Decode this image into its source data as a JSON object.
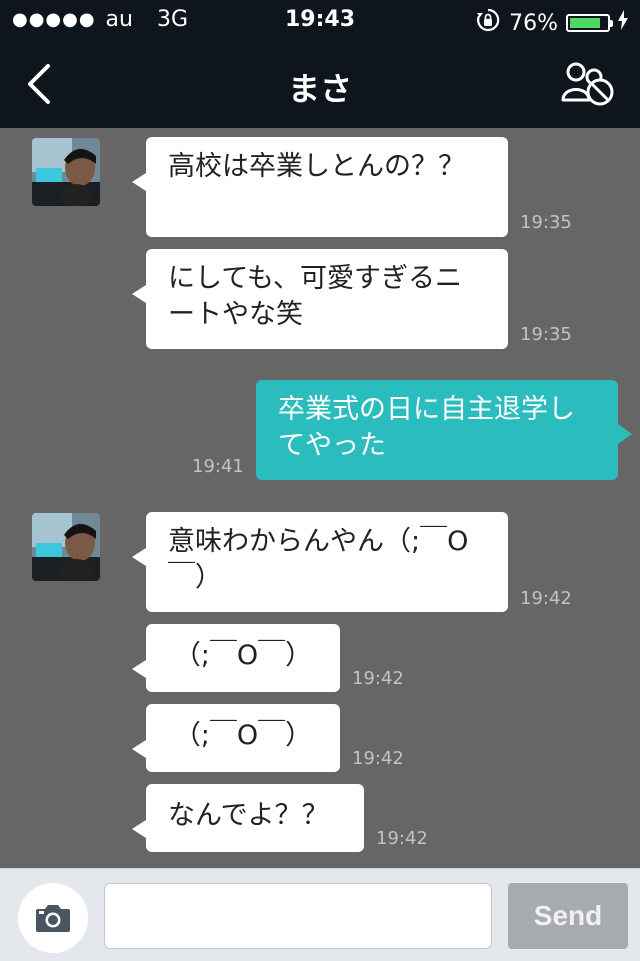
{
  "status_bar": {
    "carrier": "au",
    "network": "3G",
    "time": "19:43",
    "battery": "76%",
    "battery_level": 0.76
  },
  "header": {
    "title": "まさ"
  },
  "messages": [
    {
      "text": "高校は卒業しとんの？？",
      "time": "19:35"
    },
    {
      "text": "にしても、可愛すぎるニートやな笑",
      "time": "19:35"
    },
    {
      "text": "卒業式の日に自主退学してやった",
      "time": "19:41"
    },
    {
      "text": "意味わからんやん（;￣O￣）",
      "time": "19:42"
    },
    {
      "text": "（;￣O￣）",
      "time": "19:42"
    },
    {
      "text": "（;￣O￣）",
      "time": "19:42"
    },
    {
      "text": "なんでよ？？",
      "time": "19:42"
    }
  ],
  "input": {
    "placeholder": "",
    "value": "",
    "send_label": "Send"
  },
  "colors": {
    "nav_bg": "#0e151c",
    "chat_bg": "#666666",
    "outgoing_bubble": "#2bbcbd",
    "incoming_bubble": "#ffffff",
    "send_disabled": "#a7abb0"
  },
  "icons": {
    "back": "chevron-left-icon",
    "block": "block-user-icon",
    "camera": "camera-icon",
    "lock": "rotation-lock-icon",
    "charging": "charging-bolt-icon"
  }
}
